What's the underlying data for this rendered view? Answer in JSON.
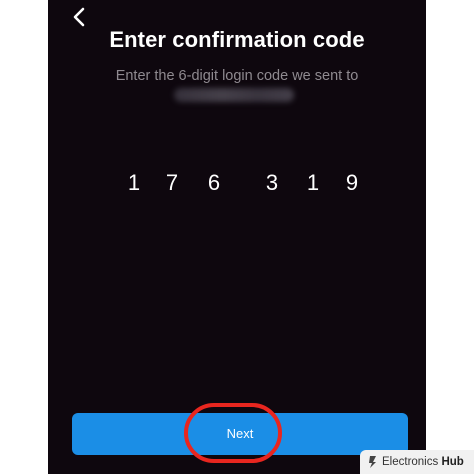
{
  "screen": {
    "title": "Enter confirmation code",
    "subtitle": "Enter the 6-digit login code we sent to",
    "back_icon": "chevron-left-icon"
  },
  "code": {
    "digits": [
      "1",
      "7",
      "6",
      "3",
      "1",
      "9"
    ]
  },
  "actions": {
    "next_label": "Next"
  },
  "annotation": {
    "ring_color": "#e8261f"
  },
  "watermark": {
    "brand_light": "Electronics ",
    "brand_bold": "Hub"
  },
  "colors": {
    "background": "#0e070e",
    "button": "#1b8ee6",
    "subtitle": "#8f8a90"
  }
}
